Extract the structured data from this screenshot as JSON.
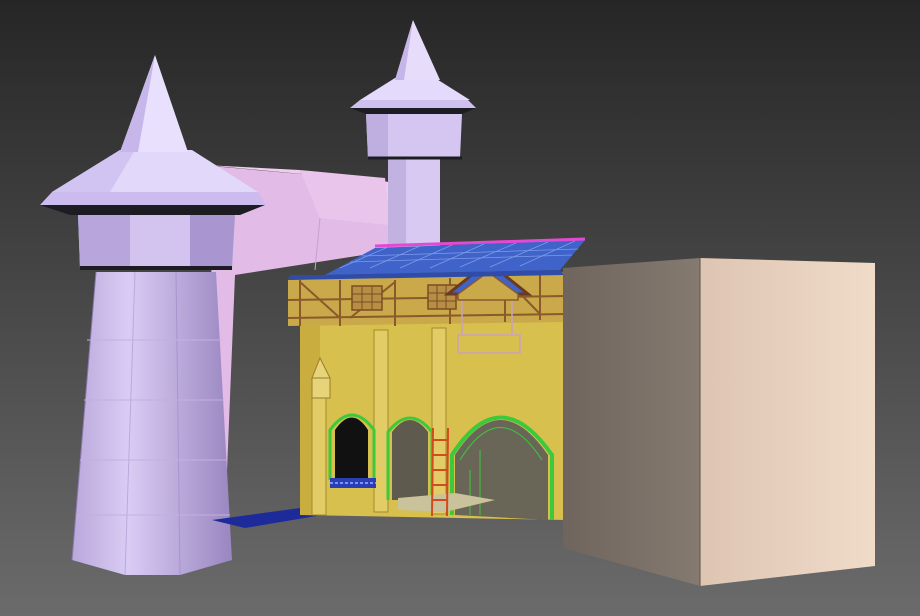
{
  "viewport": {
    "background_top": "#2a2a2a",
    "background_bottom": "#6a6a6a"
  },
  "scene": {
    "objects": [
      {
        "name": "left-tower",
        "kind": "tower",
        "color": "#d7c9f2"
      },
      {
        "name": "back-tower",
        "kind": "tower",
        "color": "#d7c9f2"
      },
      {
        "name": "back-wall",
        "kind": "wall",
        "color": "#e7c2e8"
      },
      {
        "name": "gatehouse",
        "kind": "building",
        "color": "#d9c04f"
      },
      {
        "name": "roof",
        "kind": "roof",
        "color": "#3f63c9"
      },
      {
        "name": "box",
        "kind": "box",
        "color": "#e9d3c0"
      }
    ],
    "wire_colors": {
      "timber": "#8a5a2b",
      "arch_green": "#3cc93c",
      "roof_edge": "#e24ad3",
      "ladder": "#d24a1f"
    }
  }
}
